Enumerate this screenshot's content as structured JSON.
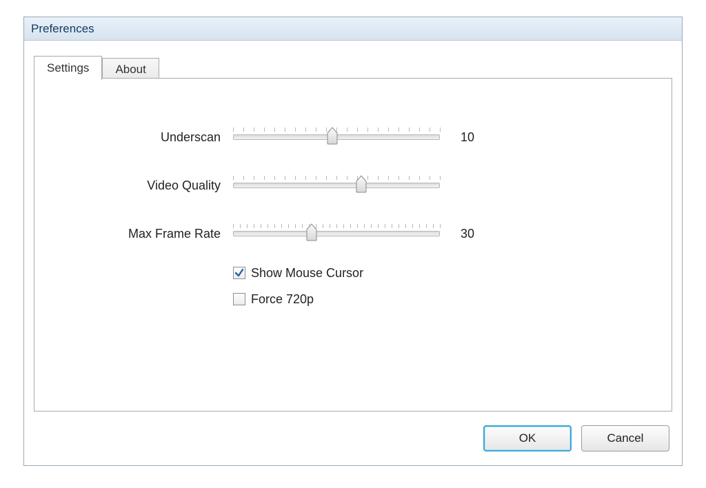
{
  "window": {
    "title": "Preferences"
  },
  "tabs": {
    "settings": "Settings",
    "about": "About",
    "active": "settings"
  },
  "sliders": {
    "underscan": {
      "label": "Underscan",
      "value_text": "10",
      "position_pct": 48
    },
    "quality": {
      "label": "Video Quality",
      "value_text": "",
      "position_pct": 62
    },
    "framerate": {
      "label": "Max Frame Rate",
      "value_text": "30",
      "position_pct": 38
    }
  },
  "checks": {
    "show_cursor": {
      "label": "Show Mouse Cursor",
      "checked": true
    },
    "force_720p": {
      "label": "Force 720p",
      "checked": false
    }
  },
  "buttons": {
    "ok": "OK",
    "cancel": "Cancel"
  }
}
